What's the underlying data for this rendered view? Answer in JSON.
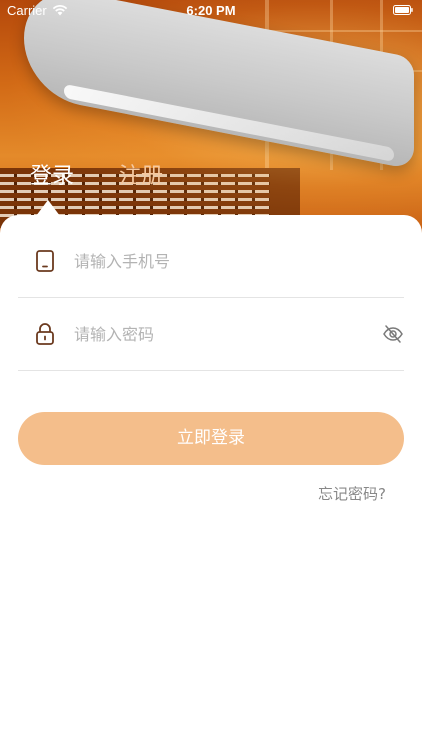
{
  "status_bar": {
    "carrier": "Carrier",
    "time": "6:20 PM"
  },
  "tabs": {
    "login": "登录",
    "register": "注册",
    "active": "login"
  },
  "form": {
    "phone": {
      "placeholder": "请输入手机号",
      "value": "",
      "icon": "phone-icon"
    },
    "password": {
      "placeholder": "请输入密码",
      "value": "",
      "icon": "lock-icon",
      "toggle_icon": "eye-slash-icon"
    },
    "submit_label": "立即登录",
    "forgot_label": "忘记密码?"
  },
  "colors": {
    "accent": "#f4be8b",
    "icon_brown": "#6b3a1f",
    "tab_inactive": "#f6c9a0"
  }
}
